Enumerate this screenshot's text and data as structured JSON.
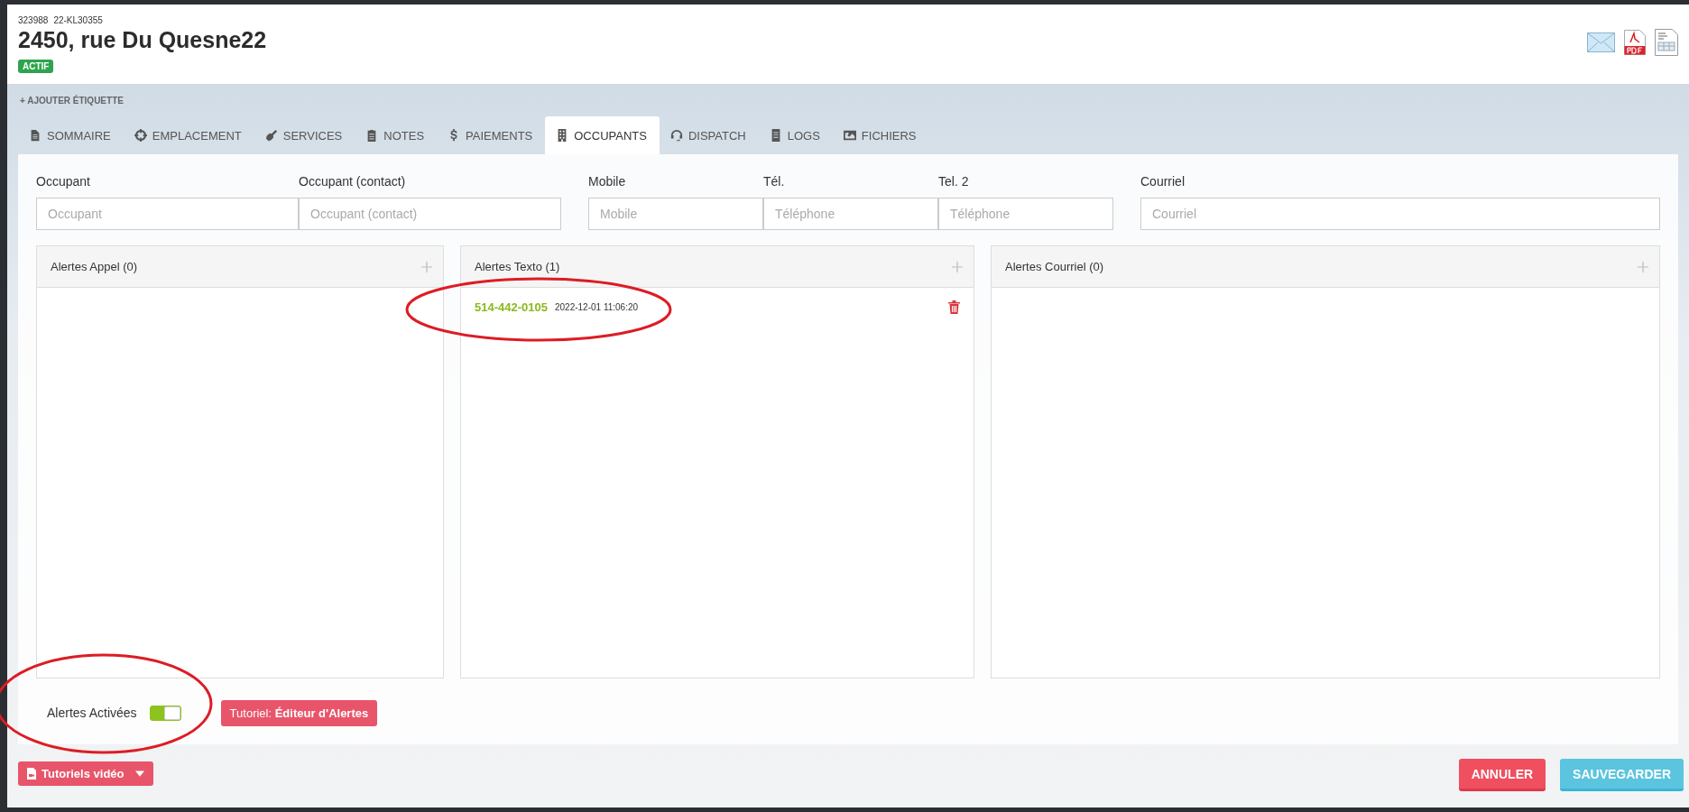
{
  "header": {
    "ids": [
      "323988",
      "22-KL30355"
    ],
    "title": "2450, rue Du Quesne22",
    "status_badge": "ACTIF"
  },
  "add_label": "+ AJOUTER ÉTIQUETTE",
  "tabs": [
    {
      "label": "SOMMAIRE",
      "selected": false
    },
    {
      "label": "EMPLACEMENT",
      "selected": false
    },
    {
      "label": "SERVICES",
      "selected": false
    },
    {
      "label": "NOTES",
      "selected": false
    },
    {
      "label": "PAIEMENTS",
      "selected": false
    },
    {
      "label": "OCCUPANTS",
      "selected": true
    },
    {
      "label": "DISPATCH",
      "selected": false
    },
    {
      "label": "LOGS",
      "selected": false
    },
    {
      "label": "FICHIERS",
      "selected": false
    }
  ],
  "field_groups": [
    [
      {
        "label": "Occupant",
        "placeholder": "Occupant"
      },
      {
        "label": "Occupant (contact)",
        "placeholder": "Occupant (contact)"
      }
    ],
    [
      {
        "label": "Mobile",
        "placeholder": "Mobile"
      },
      {
        "label": "Tél.",
        "placeholder": "Téléphone"
      },
      {
        "label": "Tel. 2",
        "placeholder": "Téléphone"
      }
    ],
    [
      {
        "label": "Courriel",
        "placeholder": "Courriel"
      }
    ]
  ],
  "alert_panels": [
    {
      "title": "Alertes Appel (0)"
    },
    {
      "title": "Alertes Texto (1)",
      "items": [
        {
          "number": "514-442-0105",
          "timestamp": "2022-12-01 11:06:20",
          "circled": true
        }
      ]
    },
    {
      "title": "Alertes Courriel (0)"
    }
  ],
  "alerts_enabled": {
    "label": "Alertes Activées",
    "on": true,
    "circled": true
  },
  "tutorial_button": "Tutoriel: **Éditeur d'Alertes**",
  "video_button": "Tutoriels vidéo",
  "footer_buttons": [
    {
      "label": "ANNULER",
      "kind": "cancel"
    },
    {
      "label": "SAUVEGARDER",
      "kind": "save"
    }
  ]
}
